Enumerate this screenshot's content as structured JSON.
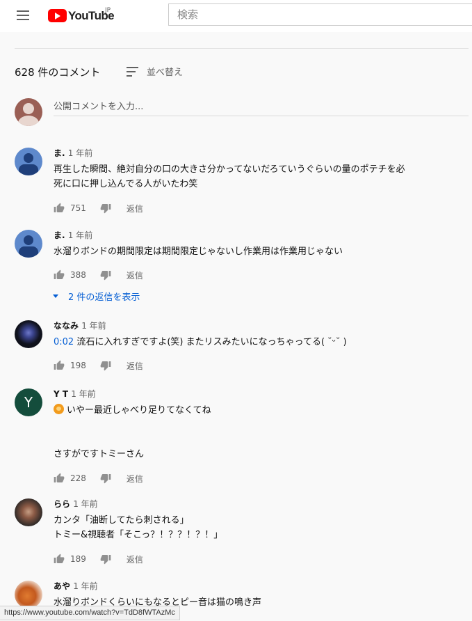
{
  "header": {
    "logo_text": "YouTube",
    "region": "JP",
    "search_placeholder": "検索"
  },
  "comments_header": {
    "count_label": "628 件のコメント",
    "sort_label": "並べ替え",
    "new_comment_placeholder": "公開コメントを入力..."
  },
  "comments": [
    {
      "author": "ま.",
      "time": "1 年前",
      "avatar": "default-person-icon",
      "lines": [
        "再生した瞬間、絶対自分の口の大きさ分かってないだろていうぐらいの量のポテチを必",
        "死に口に押し込んでる人がいたわ笑"
      ],
      "likes": "751",
      "reply_label": "返信"
    },
    {
      "author": "ま.",
      "time": "1 年前",
      "avatar": "default-person-icon",
      "lines": [
        "水溜りボンドの期間限定は期間限定じゃないし作業用は作業用じゃない"
      ],
      "likes": "388",
      "reply_label": "返信",
      "view_replies": "2 件の返信を表示"
    },
    {
      "author": "ななみ",
      "time": "1 年前",
      "avatar": "flower-photo",
      "timestamp": "0:02",
      "lines": [
        " 流石に入れすぎですよ(笑) またリスみたいになっちゃってる( ˘ᵕ˘ )"
      ],
      "likes": "198",
      "reply_label": "返信"
    },
    {
      "author": "Y T",
      "time": "1 年前",
      "avatar_letter": "Y",
      "lines": [
        "いやー最近しゃべり足りてなくてね",
        "",
        "",
        "さすがですトミーさん"
      ],
      "likes": "228",
      "reply_label": "返信"
    },
    {
      "author": "らら",
      "time": "1 年前",
      "avatar": "person-photo",
      "lines": [
        "カンタ「油断してたら刺される」",
        "トミー&視聴者「そこっ？！？？！？！」"
      ],
      "likes": "189",
      "reply_label": "返信"
    },
    {
      "author": "あや",
      "time": "1 年前",
      "avatar": "cat-photo",
      "lines": [
        "水溜りボンドくらいにもなるとピー音は猫の鳴き声"
      ]
    }
  ],
  "status_bar": {
    "url": "https://www.youtube.com/watch?v=TdD8fWTAzMc"
  },
  "colors": {
    "brand_red": "#ff0000",
    "link_blue": "#065fd4",
    "background": "#f9f9f9"
  }
}
